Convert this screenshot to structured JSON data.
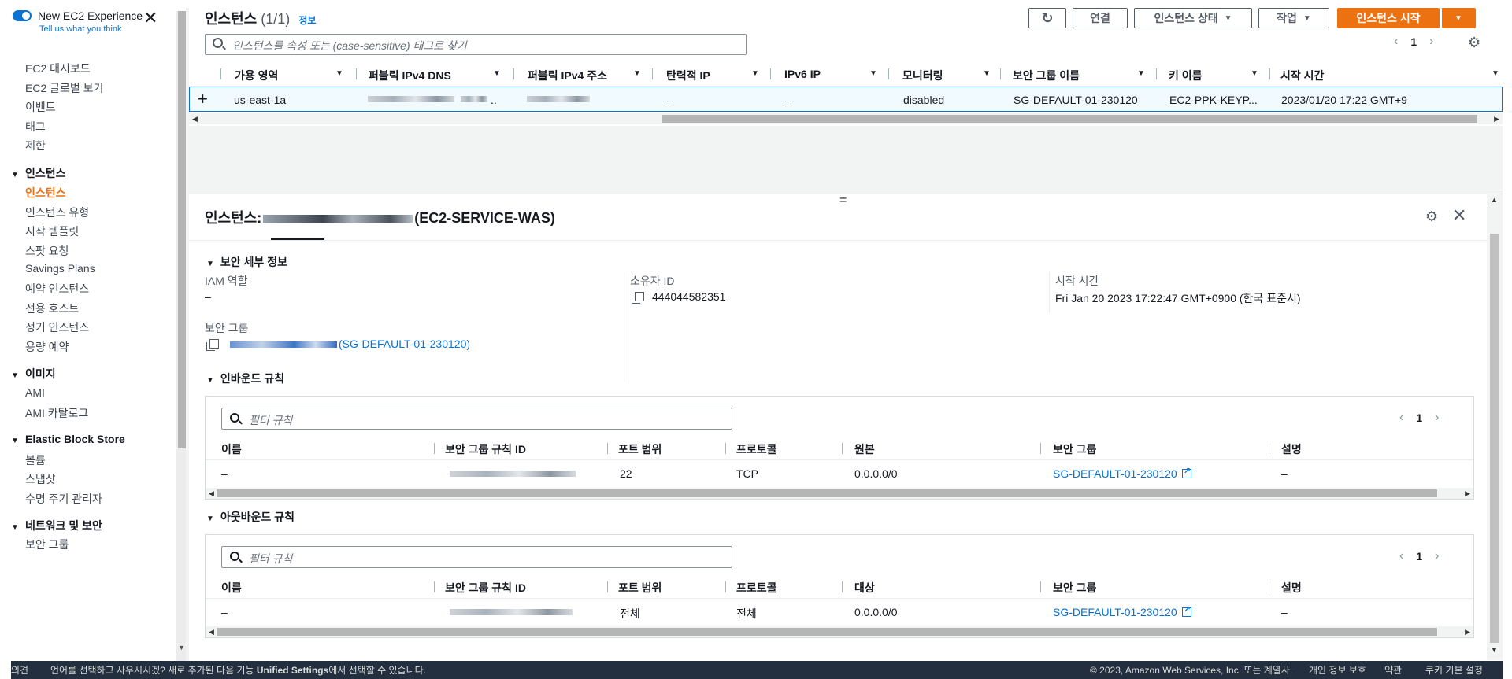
{
  "sidebar": {
    "new_experience": {
      "title": "New EC2 Experience",
      "subtitle": "Tell us what you think"
    },
    "items_top": [
      {
        "label": "EC2 대시보드"
      },
      {
        "label": "EC2 글로벌 보기"
      },
      {
        "label": "이벤트"
      },
      {
        "label": "태그"
      },
      {
        "label": "제한"
      }
    ],
    "instances_section": {
      "title": "인스턴스",
      "items": [
        {
          "label": "인스턴스",
          "active": true
        },
        {
          "label": "인스턴스 유형"
        },
        {
          "label": "시작 템플릿"
        },
        {
          "label": "스팟 요청"
        },
        {
          "label": "Savings Plans"
        },
        {
          "label": "예약 인스턴스"
        },
        {
          "label": "전용 호스트"
        },
        {
          "label": "정기 인스턴스"
        },
        {
          "label": "용량 예약"
        }
      ]
    },
    "images_section": {
      "title": "이미지",
      "items": [
        {
          "label": "AMI"
        },
        {
          "label": "AMI 카탈로그"
        }
      ]
    },
    "ebs_section": {
      "title": "Elastic Block Store",
      "items": [
        {
          "label": "볼륨"
        },
        {
          "label": "스냅샷"
        },
        {
          "label": "수명 주기 관리자"
        }
      ]
    },
    "network_section": {
      "title": "네트워크 및 보안",
      "items": [
        {
          "label": "보안 그룹"
        }
      ]
    }
  },
  "instances_panel": {
    "title": "인스턴스",
    "count": "(1/1)",
    "info_link": "정보",
    "search_placeholder": "인스턴스를 속성 또는 (case-sensitive) 태그로 찾기",
    "buttons": {
      "connect": "연결",
      "instance_state": "인스턴스 상태",
      "actions": "작업",
      "launch": "인스턴스 시작"
    },
    "page": "1",
    "columns": [
      "가용 영역",
      "퍼블릭 IPv4 DNS",
      "퍼블릭 IPv4 주소",
      "탄력적 IP",
      "IPv6 IP",
      "모니터링",
      "보안 그룹 이름",
      "키 이름",
      "시작 시간"
    ],
    "row": {
      "az": "us-east-1a",
      "public_dns": "..",
      "elastic_ip": "–",
      "ipv6": "–",
      "monitoring": "disabled",
      "sg_name": "SG-DEFAULT-01-230120",
      "key_name": "EC2-PPK-KEYP...",
      "launch_time": "2023/01/20 17:22 GMT+9"
    }
  },
  "detail": {
    "title_prefix": "인스턴스:",
    "title_suffix": "(EC2-SERVICE-WAS)",
    "security_section": {
      "title": "보안 세부 정보",
      "iam_role_label": "IAM 역할",
      "iam_role_value": "–",
      "owner_id_label": "소유자 ID",
      "owner_id_value": "444044582351",
      "launch_time_label": "시작 시간",
      "launch_time_value": "Fri Jan 20 2023 17:22:47 GMT+0900 (한국 표준시)",
      "sg_label": "보안 그룹",
      "sg_value": "(SG-DEFAULT-01-230120)"
    },
    "inbound": {
      "title": "인바운드 규칙",
      "filter_placeholder": "필터 규칙",
      "page": "1",
      "columns": [
        "이름",
        "보안 그룹 규칙 ID",
        "포트 범위",
        "프로토콜",
        "원본",
        "보안 그룹",
        "설명"
      ],
      "row": {
        "name": "–",
        "port": "22",
        "protocol": "TCP",
        "source": "0.0.0.0/0",
        "sg": "SG-DEFAULT-01-230120",
        "desc": "–"
      }
    },
    "outbound": {
      "title": "아웃바운드 규칙",
      "filter_placeholder": "필터 규칙",
      "page": "1",
      "columns": [
        "이름",
        "보안 그룹 규칙 ID",
        "포트 범위",
        "프로토콜",
        "대상",
        "보안 그룹",
        "설명"
      ],
      "row": {
        "name": "–",
        "port": "전체",
        "protocol": "전체",
        "dest": "0.0.0.0/0",
        "sg": "SG-DEFAULT-01-230120",
        "desc": "–"
      }
    }
  },
  "footer": {
    "left_label": "의견",
    "notice_pre": "언어를 선택하고 사우시시겠? 새로 추가된 다음 기능",
    "notice_link": "Unified Settings",
    "notice_post": "에서 선택할 수 있습니다.",
    "copyright": "© 2023, Amazon Web Services, Inc. 또는 계열사.",
    "privacy": "개인 정보 보호",
    "terms": "약관",
    "cookies": "쿠키 기본 설정"
  },
  "colors": {
    "accent": "#0972d3",
    "primary_button": "#ec7211",
    "active_nav": "#ec7211",
    "footer_bg": "#232f3e"
  }
}
